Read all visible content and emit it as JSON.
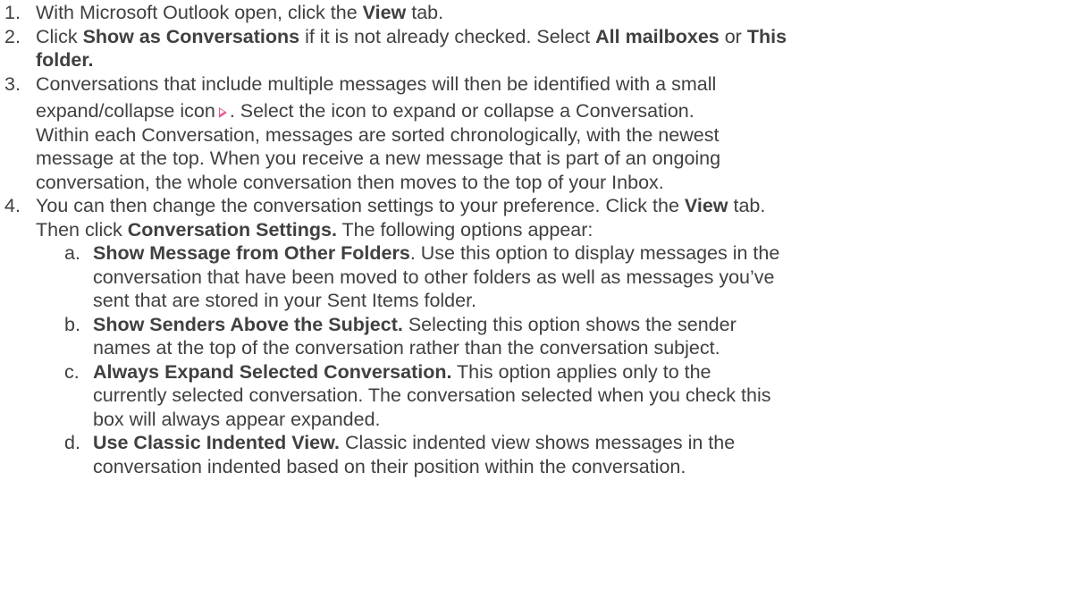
{
  "steps": [
    {
      "num": "1.",
      "t1": "With Microsoft Outlook open, click the ",
      "b1": "View",
      "t2": " tab."
    },
    {
      "num": "2.",
      "t1": "Click ",
      "b1": "Show as Conversations",
      "t2": " if it is not already checked. Select ",
      "b2": "All mailboxes",
      "t3": " or ",
      "b3": "This",
      "b4": "folder."
    },
    {
      "num": "3.",
      "t1": "Conversations that include multiple messages will then be identified with a small",
      "t2": "expand/collapse icon",
      "t3": ". Select the icon to expand or collapse a Conversation.",
      "t4": "Within each Conversation, messages are sorted chronologically, with the newest",
      "t5": "message at the top. When you receive a new message that is part of an ongoing",
      "t6": "conversation, the whole conversation then moves to the top of your Inbox."
    },
    {
      "num": "4.",
      "t1": "You can then change the conversation settings to your preference. Click the ",
      "b1": "View",
      "t2": " tab.",
      "t3": "Then click ",
      "b2": "Conversation Settings.",
      "t4": " The following options appear:"
    }
  ],
  "options": [
    {
      "letter": "a.",
      "title": "Show Message from Other Folders",
      "l1": ". Use this option to display messages in the",
      "l2": "conversation that have been moved to other folders as well as messages you’ve",
      "l3": "sent that are stored in your Sent Items folder."
    },
    {
      "letter": "b.",
      "title": "Show Senders Above the Subject.",
      "l1": " Selecting this option shows the sender",
      "l2": "names at the top of the conversation rather than the conversation subject."
    },
    {
      "letter": "c.",
      "title": "Always Expand Selected Conversation.",
      "l1": " This option applies only to the",
      "l2": "currently selected conversation. The conversation selected when you check this",
      "l3": "box will always appear expanded."
    },
    {
      "letter": "d.",
      "title": "Use Classic Indented View.",
      "l1": " Classic indented view shows messages in the",
      "l2": "conversation indented based on their position within the conversation."
    }
  ],
  "icons": {
    "expand_collapse": "expand-collapse-icon",
    "expand_color": "#e35c9a"
  }
}
